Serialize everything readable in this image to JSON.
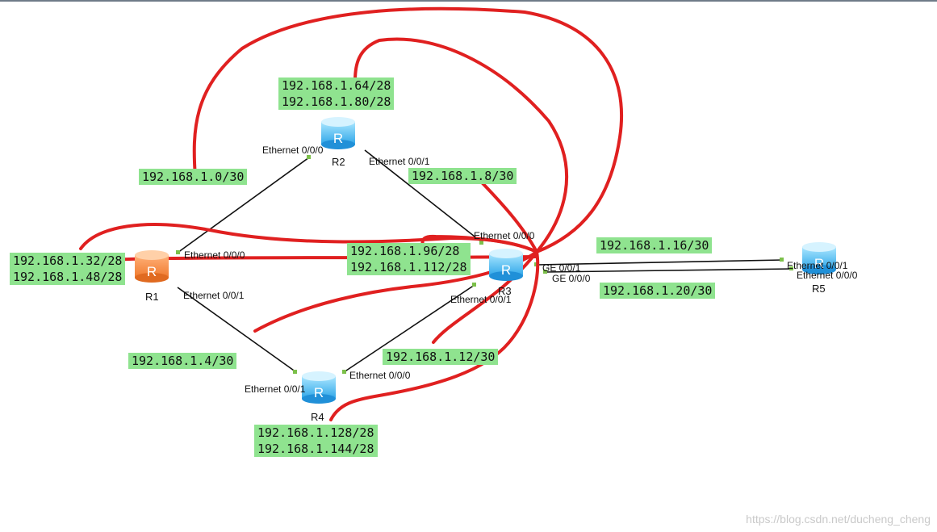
{
  "routers": [
    {
      "id": "r1",
      "name": "R1",
      "color": "orange"
    },
    {
      "id": "r2",
      "name": "R2",
      "color": "blue"
    },
    {
      "id": "r3",
      "name": "R3",
      "color": "blue"
    },
    {
      "id": "r4",
      "name": "R4",
      "color": "blue"
    },
    {
      "id": "r5",
      "name": "R5",
      "color": "blue"
    }
  ],
  "router_glyph": "R",
  "interfaces": {
    "r2_e000": "Ethernet 0/0/0",
    "r2_e001": "Ethernet 0/0/1",
    "r1_e000": "Ethernet 0/0/0",
    "r1_e001": "Ethernet 0/0/1",
    "r3_e000": "Ethernet 0/0/0",
    "r3_e001": "Ethernet 0/0/1",
    "r3_ge001": "GE 0/0/1",
    "r3_ge000": "GE 0/0/0",
    "r4_e000": "Ethernet 0/0/0",
    "r4_e001": "Ethernet 0/0/1",
    "r5_e001": "Ethernet 0/0/1",
    "r5_e000": "Ethernet 0/0/0"
  },
  "subnets": {
    "r2_loopbacks": [
      "192.168.1.64/28",
      "192.168.1.80/28"
    ],
    "r1_r2": "192.168.1.0/30",
    "r2_r3": "192.168.1.8/30",
    "r1_loopbacks": [
      "192.168.1.32/28",
      "192.168.1.48/28"
    ],
    "r3_loopbacks": [
      "192.168.1.96/28",
      "192.168.1.112/28"
    ],
    "r3_r5_a": "192.168.1.16/30",
    "r3_r5_b": "192.168.1.20/30",
    "r1_r4": "192.168.1.4/30",
    "r3_r4": "192.168.1.12/30",
    "r4_loopbacks": [
      "192.168.1.128/28",
      "192.168.1.144/28"
    ]
  },
  "colors": {
    "highlight": "#8fe38f",
    "annotation": "#e02020",
    "link": "#111111",
    "port": "#7cc04a"
  },
  "watermark": "https://blog.csdn.net/ducheng_cheng"
}
